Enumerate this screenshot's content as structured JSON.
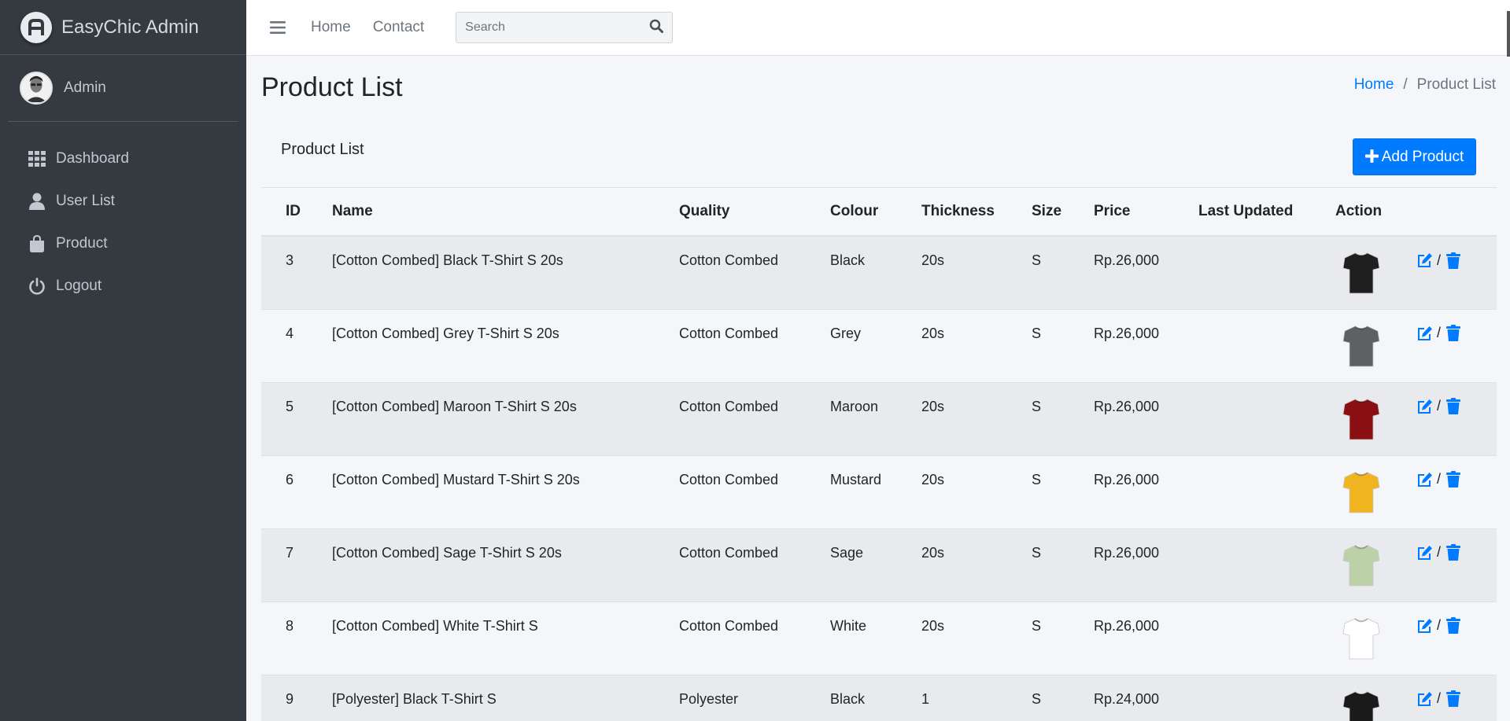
{
  "brand": {
    "name": "EasyChic Admin",
    "logo_icon": "easychic-logo"
  },
  "user": {
    "name": "Admin"
  },
  "sidebar": {
    "items": [
      {
        "label": "Dashboard",
        "icon": "grid-icon"
      },
      {
        "label": "User List",
        "icon": "user-icon"
      },
      {
        "label": "Product",
        "icon": "shopping-bag-icon"
      },
      {
        "label": "Logout",
        "icon": "power-icon"
      }
    ]
  },
  "topbar": {
    "links": [
      "Home",
      "Contact"
    ],
    "search_placeholder": "Search"
  },
  "page": {
    "title": "Product List",
    "breadcrumb": {
      "home": "Home",
      "separator": "/",
      "current": "Product List"
    }
  },
  "card": {
    "title": "Product List",
    "add_button": "Add Product"
  },
  "table": {
    "headers": {
      "id": "ID",
      "name": "Name",
      "quality": "Quality",
      "colour": "Colour",
      "thickness": "Thickness",
      "size": "Size",
      "price": "Price",
      "last_updated": "Last Updated",
      "action": "Action"
    },
    "action_separator": "/",
    "rows": [
      {
        "id": "3",
        "name": "[Cotton Combed] Black T-Shirt S 20s",
        "quality": "Cotton Combed",
        "colour": "Black",
        "thickness": "20s",
        "size": "S",
        "price": "Rp.26,000",
        "last_updated": "",
        "shirt_color": "#1f1f1f"
      },
      {
        "id": "4",
        "name": "[Cotton Combed] Grey T-Shirt S 20s",
        "quality": "Cotton Combed",
        "colour": "Grey",
        "thickness": "20s",
        "size": "S",
        "price": "Rp.26,000",
        "last_updated": "",
        "shirt_color": "#5f6062"
      },
      {
        "id": "5",
        "name": "[Cotton Combed] Maroon T-Shirt S 20s",
        "quality": "Cotton Combed",
        "colour": "Maroon",
        "thickness": "20s",
        "size": "S",
        "price": "Rp.26,000",
        "last_updated": "",
        "shirt_color": "#8b0f12"
      },
      {
        "id": "6",
        "name": "[Cotton Combed] Mustard T-Shirt S 20s",
        "quality": "Cotton Combed",
        "colour": "Mustard",
        "thickness": "20s",
        "size": "S",
        "price": "Rp.26,000",
        "last_updated": "",
        "shirt_color": "#f1b421"
      },
      {
        "id": "7",
        "name": "[Cotton Combed] Sage T-Shirt S 20s",
        "quality": "Cotton Combed",
        "colour": "Sage",
        "thickness": "20s",
        "size": "S",
        "price": "Rp.26,000",
        "last_updated": "",
        "shirt_color": "#bcd1a8"
      },
      {
        "id": "8",
        "name": "[Cotton Combed] White T-Shirt S",
        "quality": "Cotton Combed",
        "colour": "White",
        "thickness": "20s",
        "size": "S",
        "price": "Rp.26,000",
        "last_updated": "",
        "shirt_color": "#ffffff"
      },
      {
        "id": "9",
        "name": "[Polyester] Black T-Shirt S",
        "quality": "Polyester",
        "colour": "Black",
        "thickness": "1",
        "size": "S",
        "price": "Rp.24,000",
        "last_updated": "",
        "shirt_color": "#1a1a1a"
      }
    ]
  },
  "colors": {
    "sidebar_bg": "#343a40",
    "accent": "#007bff",
    "content_bg": "#f4f6f9"
  }
}
